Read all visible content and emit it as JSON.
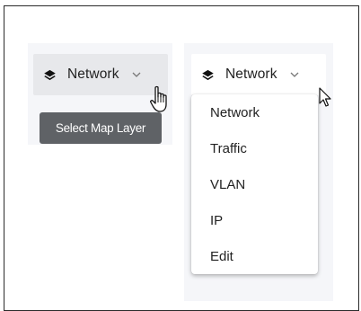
{
  "layer_selector_hover": {
    "icon": "layers-icon",
    "label": "Network",
    "chevron": "chevron-down-icon",
    "tooltip": "Select Map Layer"
  },
  "layer_selector_open": {
    "icon": "layers-icon",
    "label": "Network",
    "chevron": "chevron-down-icon",
    "menu_items": [
      "Network",
      "Traffic",
      "VLAN",
      "IP",
      "Edit"
    ]
  },
  "cursors": {
    "hover": "hand-pointer-icon",
    "open": "arrow-pointer-icon"
  },
  "colors": {
    "tooltip_bg": "#5f6266",
    "selector_hover_bg": "#e7e8eb",
    "panel_bg": "#f5f6f9"
  }
}
